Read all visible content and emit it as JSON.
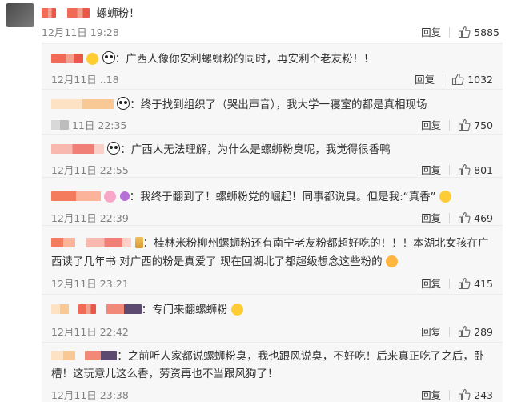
{
  "top_comment": {
    "text": "螺蛳粉！",
    "meta": "12月11日 19:28",
    "reply_label": "回复",
    "likes": "5885"
  },
  "replies": [
    {
      "text": "广西人像你安利螺蛳粉的同时，再安利个老友粉！！",
      "meta": "12月11日 ..18",
      "reply_label": "回复",
      "likes": "1032"
    },
    {
      "text": "终于找到组织了（哭出声音），我大学一寝室的都是真相现场",
      "meta": "11日 22:35",
      "reply_label": "回复",
      "likes": "750"
    },
    {
      "text": "广西人无法理解，为什么是螺蛳粉臭呢，我觉得很香鸭",
      "meta": "12月11日 22:55",
      "reply_label": "回复",
      "likes": "801"
    },
    {
      "text": "我终于翻到了！螺蛳粉党的崛起！同事都说臭。但是我:“真香”",
      "meta": "12月11日 22:39",
      "reply_label": "回复",
      "likes": "469"
    },
    {
      "text_line1": "桂林米粉柳州螺蛳粉还有南宁老友粉都超好吃的！！！本湖北女孩在广",
      "text_line2": "西读了几年书 对广西的粉是真爱了 现在回湖北了都超级想念这些粉的",
      "meta": "12月11日 23:21",
      "reply_label": "回复",
      "likes": "415"
    },
    {
      "text": "专门来翻螺蛳粉",
      "meta": "12月11日 22:42",
      "reply_label": "回复",
      "likes": "289"
    },
    {
      "text_line1": "之前听人家都说螺蛳粉臭，我也跟风说臭，不好吃！后来真正吃了之后，卧",
      "text_line2": "槽！这玩意儿这么香，劳资再也不当跟风狗了！",
      "meta": "12月11日 23:38",
      "reply_label": "回复",
      "likes": "243"
    }
  ]
}
